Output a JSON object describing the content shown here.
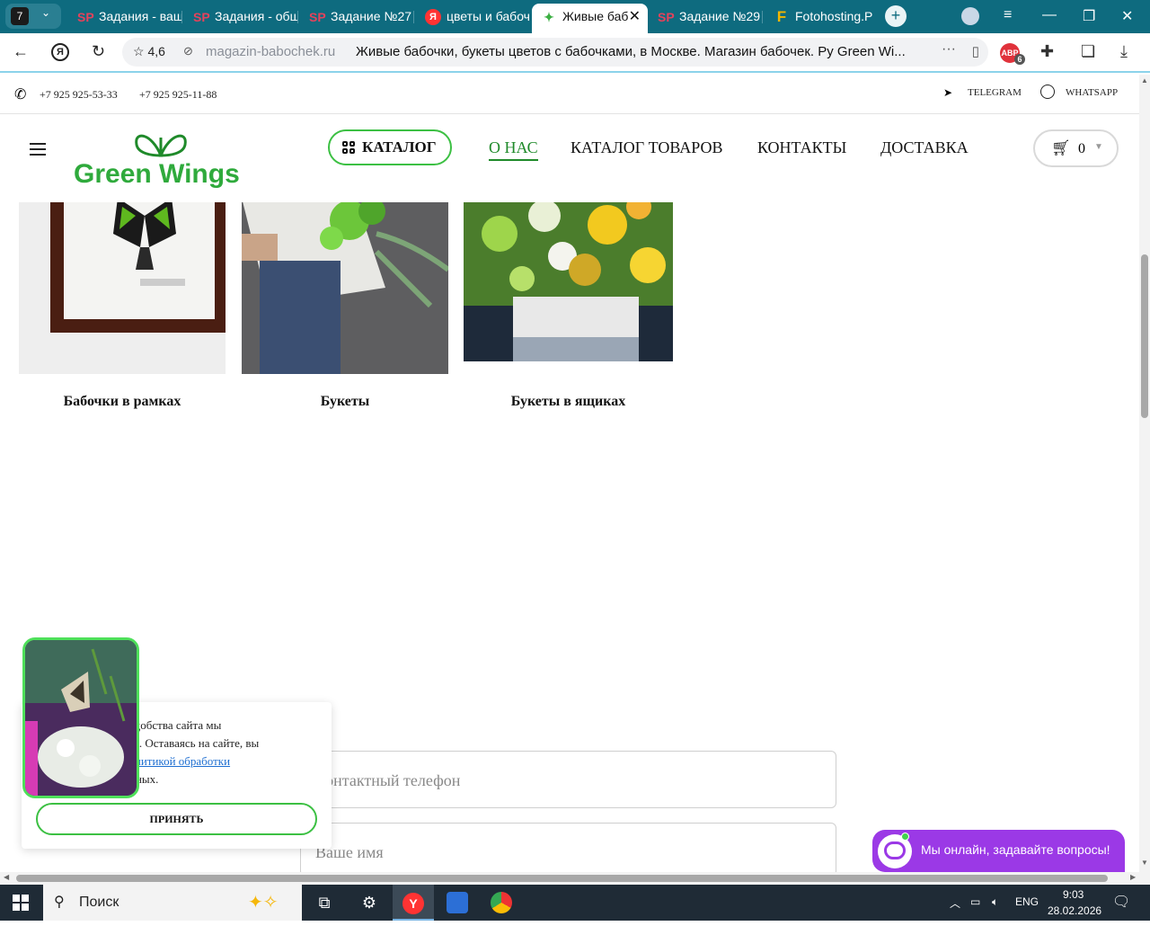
{
  "browser": {
    "tab_count": "7",
    "tabs": [
      {
        "label": "Задания - ваш",
        "icon": "SP"
      },
      {
        "label": "Задания - общ",
        "icon": "SP"
      },
      {
        "label": "Задание №27",
        "icon": "SP"
      },
      {
        "label": "цветы и бабоч",
        "icon": "Я"
      },
      {
        "label": "Живые баб",
        "icon": "✦"
      },
      {
        "label": "Задание №29",
        "icon": "SP"
      },
      {
        "label": "Fotohosting.P",
        "icon": "F"
      }
    ],
    "rating": "4,6",
    "domain": "magazin-babochek.ru",
    "page_title": "Живые бабочки, букеты цветов с бабочками, в Москве. Магазин бабочек. Ру Green Wi...",
    "abp_badge": "6"
  },
  "site": {
    "phones": [
      "+7 925 925-53-33",
      "+7 925 925-11-88"
    ],
    "telegram": "TELEGRAM",
    "whatsapp": "WHATSAPP",
    "logo_text": "Green Wings",
    "catalog_button": "КАТАЛОГ",
    "nav": [
      "О НАС",
      "КАТАЛОГ ТОВАРОВ",
      "КОНТАКТЫ",
      "ДОСТАВКА"
    ],
    "cart_count": "0",
    "cards": [
      {
        "title": "Бабочки в рамках"
      },
      {
        "title": "Букеты"
      },
      {
        "title": "Букеты в ящиках"
      }
    ],
    "form": {
      "phone_placeholder": "Контактный телефон",
      "name_placeholder": "Ваше имя"
    },
    "cookie": {
      "line1": "удобства сайта мы",
      "line2": "es. Оставаясь на сайте, вы",
      "link": "олитикой обработки",
      "line4": "нных.",
      "accept": "ПРИНЯТЬ"
    },
    "chat_label": "Мы онлайн, задавайте вопросы!"
  },
  "taskbar": {
    "search_placeholder": "Поиск",
    "lang": "ENG",
    "time": "9:03",
    "date": "28.02.2026"
  },
  "colors": {
    "tabbar": "#0e6b7f",
    "brand_green": "#2faa3c",
    "chat_purple": "#9b39e6"
  }
}
